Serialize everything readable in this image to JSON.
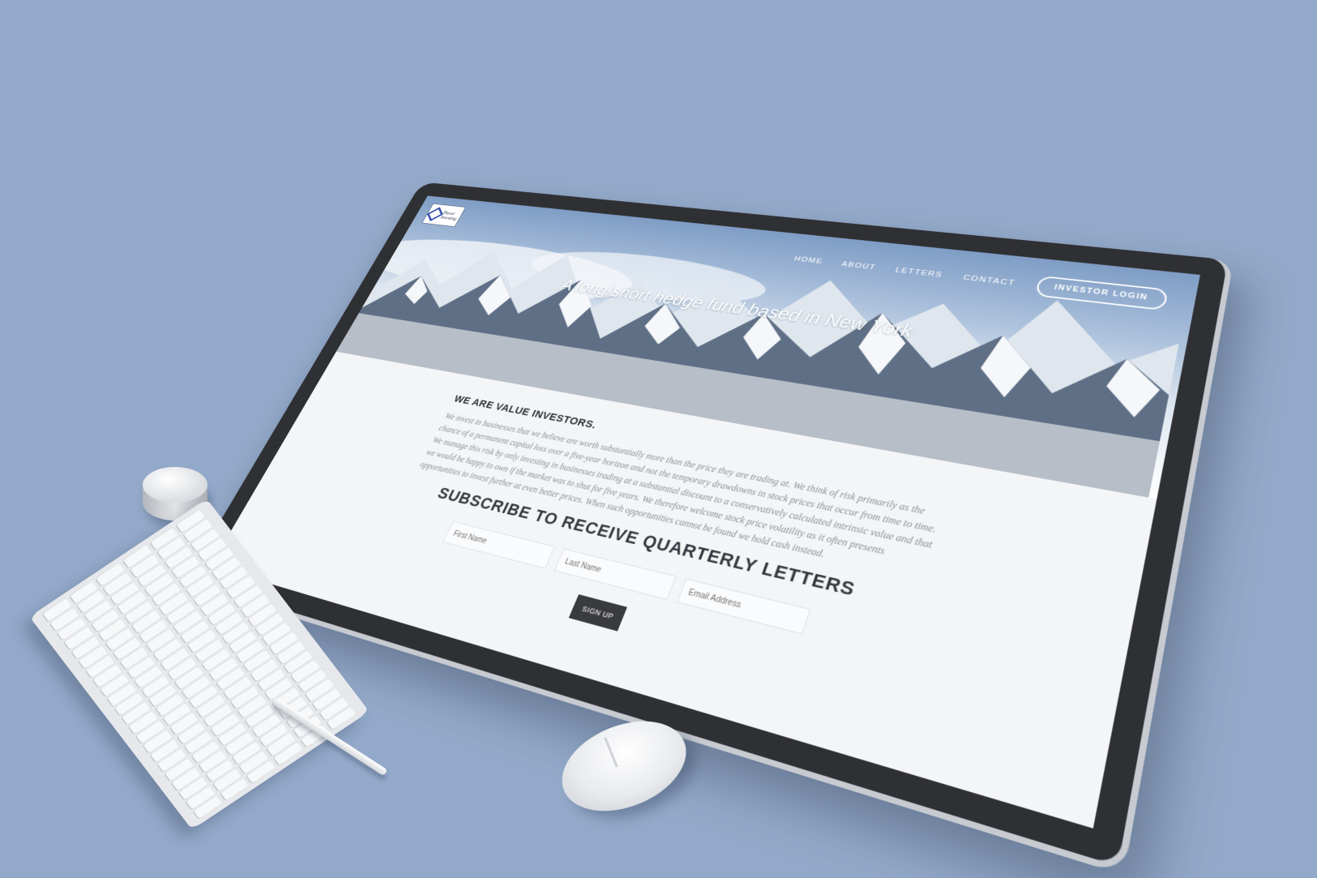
{
  "site": {
    "logo_text": "Plural Investing",
    "nav": {
      "items": [
        "HOME",
        "ABOUT",
        "LETTERS",
        "CONTACT"
      ],
      "login_label": "INVESTOR LOGIN"
    },
    "hero": {
      "tagline": "A long/short hedge fund based in New York"
    },
    "about": {
      "heading": "WE ARE VALUE INVESTORS.",
      "body": "We invest in businesses that we believe are worth substantially more than the price they are trading at. We think of risk primarily as the chance of a permanent capital loss over a five-year horizon and not the temporary drawdowns in stock prices that occur from time to time. We manage this risk by only investing in businesses trading at a substantial discount to a conservatively calculated intrinsic value and that we would be happy to own if the market was to shut for five years. We therefore welcome stock price volatility as it often presents opportunities to invest further at even better prices. When such opportunities cannot be found we hold cash instead."
    },
    "subscribe": {
      "heading": "SUBSCRIBE TO RECEIVE QUARTERLY LETTERS",
      "fields": [
        {
          "placeholder": "First Name"
        },
        {
          "placeholder": "Last Name"
        },
        {
          "placeholder": "Email Address"
        }
      ],
      "button_label": "SIGN UP"
    }
  },
  "colors": {
    "background": "#93a9c9",
    "bezel": "#2f3033",
    "button_dark": "#3a3b3e"
  }
}
